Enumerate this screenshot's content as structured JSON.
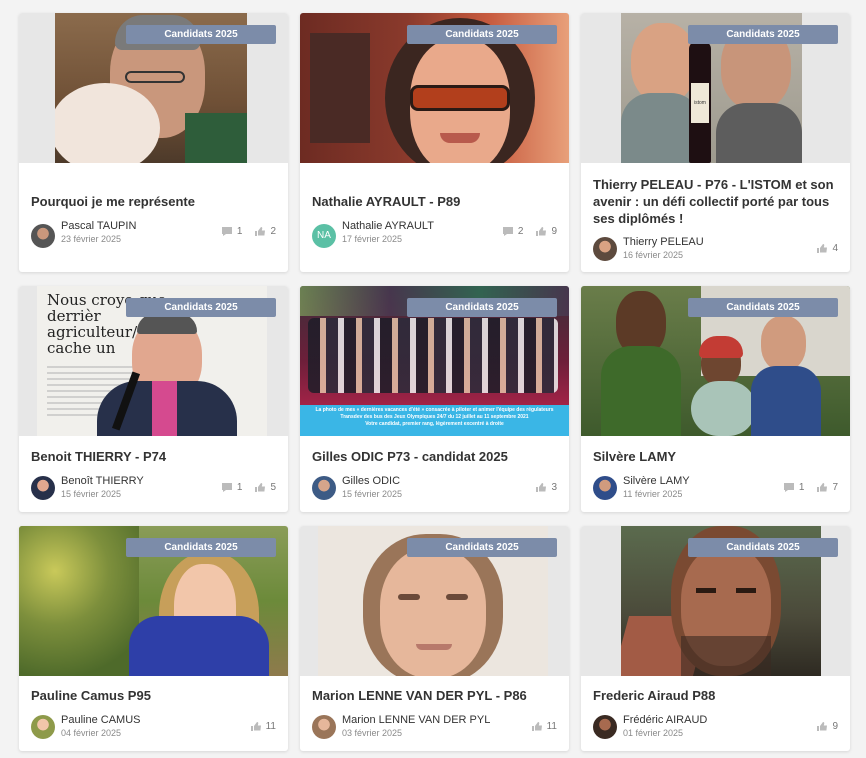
{
  "badge_label": "Candidats 2025",
  "cards": [
    {
      "title": "Pourquoi je me représente",
      "author": "Pascal TAUPIN",
      "date": "23 février 2025",
      "comments": "1",
      "likes": "2"
    },
    {
      "title": "Nathalie AYRAULT - P89",
      "author": "Nathalie AYRAULT",
      "initials": "NA",
      "date": "17 février 2025",
      "comments": "2",
      "likes": "9"
    },
    {
      "title": "Thierry PELEAU - P76 - L'ISTOM et son avenir : un défi collectif porté par tous ses diplômés !",
      "author": "Thierry PELEAU",
      "date": "16 février 2025",
      "likes": "4"
    },
    {
      "title": "Benoit THIERRY - P74",
      "author": "Benoît THIERRY",
      "date": "15 février 2025",
      "comments": "1",
      "likes": "5"
    },
    {
      "title": "Gilles ODIC P73 - candidat 2025",
      "author": "Gilles ODIC",
      "date": "15 février 2025",
      "likes": "3"
    },
    {
      "title": "Silvère LAMY",
      "author": "Silvère LAMY",
      "date": "11 février 2025",
      "comments": "1",
      "likes": "7"
    },
    {
      "title": "Pauline Camus P95",
      "author": "Pauline CAMUS",
      "date": "04 février 2025",
      "likes": "11"
    },
    {
      "title": "Marion LENNE VAN DER PYL - P86",
      "author": "Marion LENNE VAN DER PYL",
      "date": "03 février 2025",
      "likes": "11"
    },
    {
      "title": "Frederic Airaud P88",
      "author": "Frédéric AIRAUD",
      "date": "01 février 2025",
      "likes": "9"
    }
  ],
  "image_text": {
    "benoit_poster": "Nous croyo que derrièr agriculteur/t se cache un",
    "gilles_caption": "La photo de mes « dernières vacances d'été » consacrée à piloter et animer l'équipe des régulateurs Transdev des bus des Jeux Olympiques 24/7 du 12 juillet au 11 septembre 2021",
    "gilles_caption_2": "Votre candidat, premier rang, légèrement excentré à droite",
    "wine_label": "istom"
  },
  "colors": {
    "page_background": "#f3f3f3",
    "badge_background": "#7c8ca9",
    "initials_avatar": "#5bc0a5",
    "caption_band": "#3ab6e6"
  },
  "icons": [
    "comment-icon",
    "thumbs-up-icon"
  ]
}
